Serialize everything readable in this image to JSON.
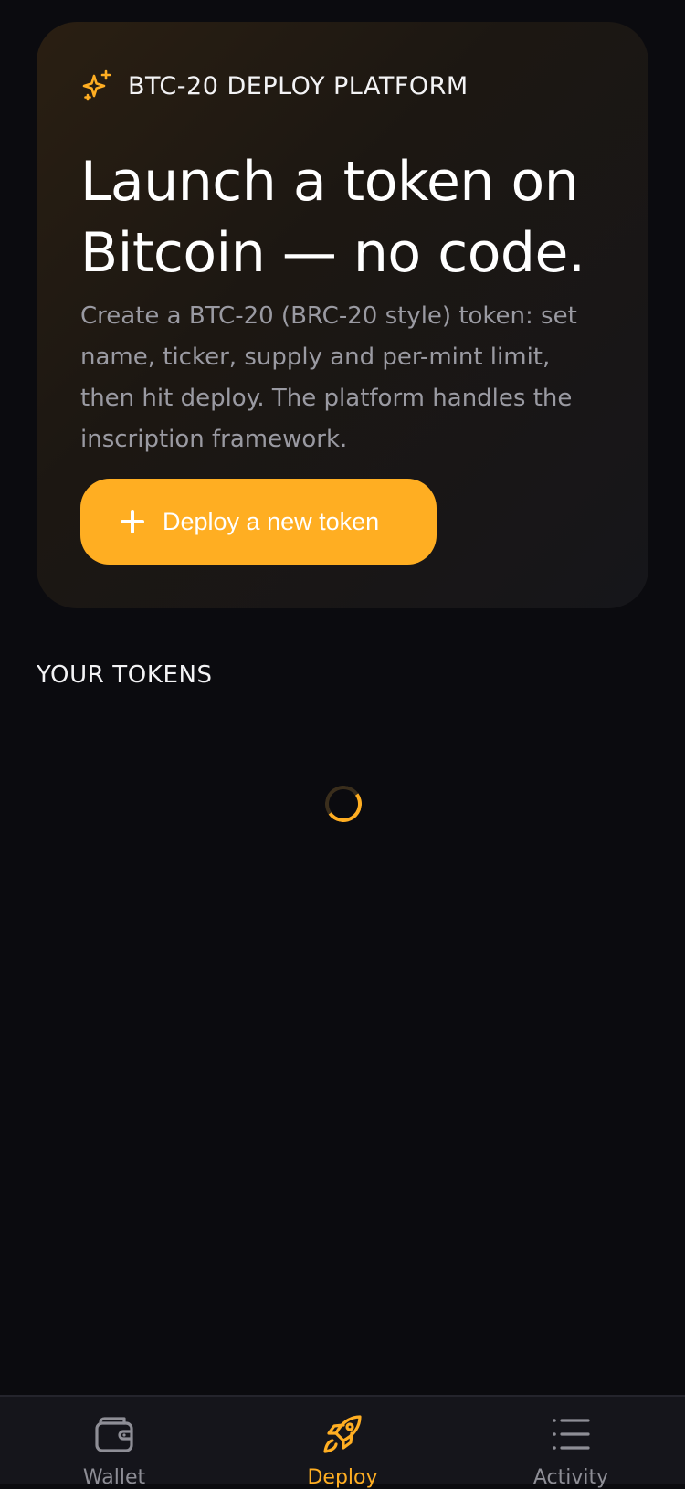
{
  "hero": {
    "badge": "BTC-20 DEPLOY PLATFORM",
    "badge_icon": "sparkles-icon",
    "headline_line1": "Launch a token on",
    "headline_line2": "Bitcoin — no code.",
    "description": "Create a BTC-20 (BRC-20 style) token: set name, ticker, supply and per-mint limit, then hit deploy. The platform handles the inscription framework.",
    "deploy_button_label": "Deploy a new token",
    "deploy_button_icon": "plus-icon"
  },
  "tokens": {
    "section_title": "YOUR TOKENS",
    "loading": true
  },
  "tabbar": {
    "tabs": [
      {
        "label": "Wallet",
        "icon": "wallet-icon",
        "active": false
      },
      {
        "label": "Deploy",
        "icon": "rocket-icon",
        "active": true
      },
      {
        "label": "Activity",
        "icon": "list-icon",
        "active": false
      }
    ]
  },
  "colors": {
    "accent": "#ffae22",
    "background": "#0b0b0f",
    "muted_text": "#9a9aa2",
    "tab_inactive": "#8e8e96"
  }
}
